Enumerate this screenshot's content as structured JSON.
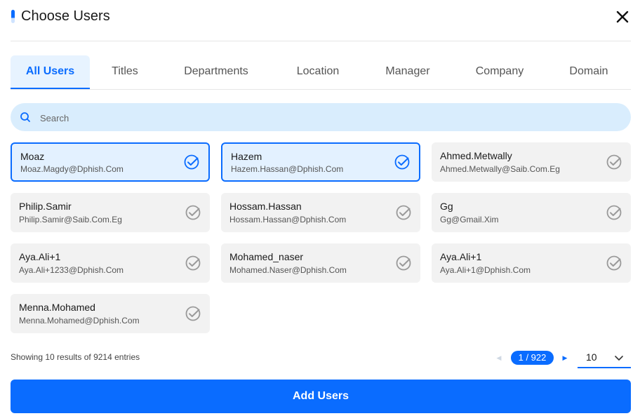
{
  "dialog": {
    "title": "Choose Users"
  },
  "tabs": [
    {
      "label": "All Users",
      "active": true
    },
    {
      "label": "Titles",
      "active": false
    },
    {
      "label": "Departments",
      "active": false
    },
    {
      "label": "Location",
      "active": false
    },
    {
      "label": "Manager",
      "active": false
    },
    {
      "label": "Company",
      "active": false
    },
    {
      "label": "Domain",
      "active": false
    }
  ],
  "search": {
    "placeholder": "Search",
    "value": ""
  },
  "users": [
    {
      "name": "Moaz",
      "email": "Moaz.Magdy@Dphish.Com",
      "selected": true
    },
    {
      "name": "Hazem",
      "email": "Hazem.Hassan@Dphish.Com",
      "selected": true
    },
    {
      "name": "Ahmed.Metwally",
      "email": "Ahmed.Metwally@Saib.Com.Eg",
      "selected": false
    },
    {
      "name": "Philip.Samir",
      "email": "Philip.Samir@Saib.Com.Eg",
      "selected": false
    },
    {
      "name": "Hossam.Hassan",
      "email": "Hossam.Hassan@Dphish.Com",
      "selected": false
    },
    {
      "name": "Gg",
      "email": "Gg@Gmail.Xim",
      "selected": false
    },
    {
      "name": "Aya.Ali+1",
      "email": "Aya.Ali+1233@Dphish.Com",
      "selected": false
    },
    {
      "name": "Mohamed_naser",
      "email": "Mohamed.Naser@Dphish.Com",
      "selected": false
    },
    {
      "name": "Aya.Ali+1",
      "email": "Aya.Ali+1@Dphish.Com",
      "selected": false
    },
    {
      "name": "Menna.Mohamed",
      "email": "Menna.Mohamed@Dphish.Com",
      "selected": false
    }
  ],
  "footer": {
    "showing_text": "Showing 10 results of 9214 entries",
    "page_indicator": "1 / 922",
    "page_size": "10"
  },
  "actions": {
    "add_label": "Add Users"
  },
  "colors": {
    "accent": "#0a6cff",
    "selected_bg": "#e3f1ff",
    "search_bg": "#d9edfd",
    "card_bg": "#f2f2f2"
  },
  "icons": {
    "close": "close-icon",
    "search": "search-icon",
    "check": "check-circle-icon",
    "chevron": "chevron-down-icon"
  }
}
